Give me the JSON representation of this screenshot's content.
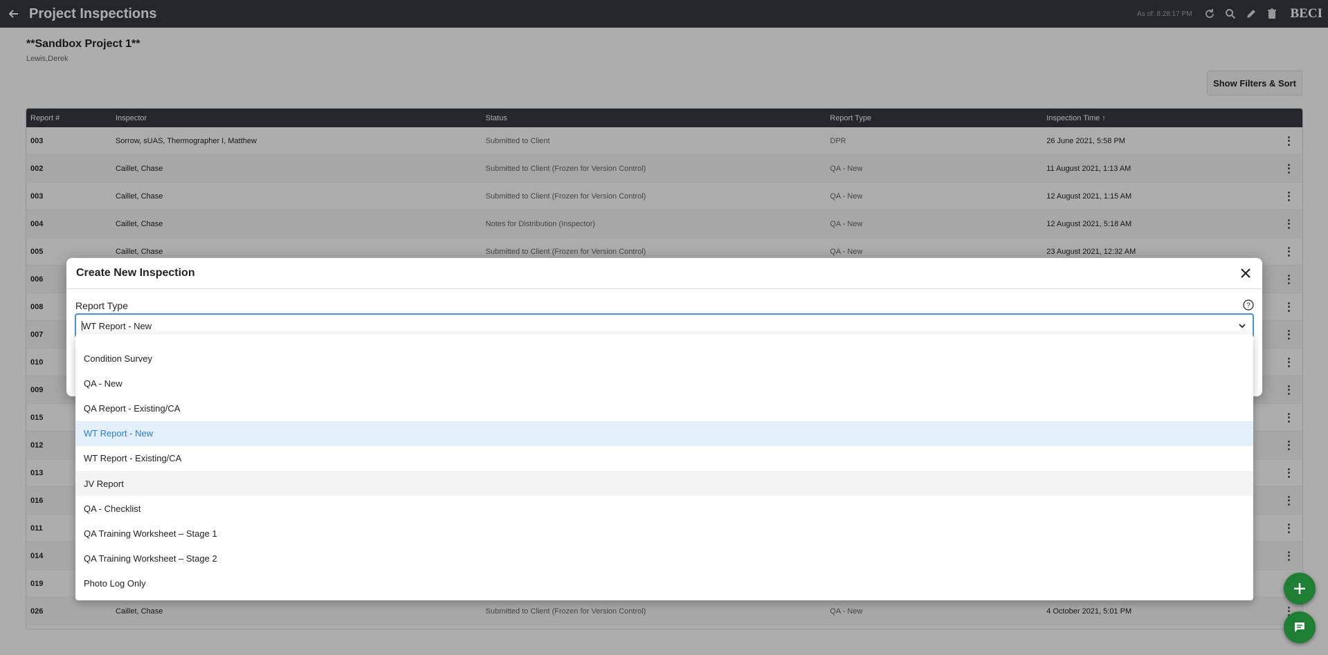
{
  "topbar": {
    "title": "Project Inspections",
    "as_of": "As of: 8:28:17 PM",
    "brand": "BECI"
  },
  "project": {
    "title": "**Sandbox Project 1**",
    "owner": "Lewis,Derek"
  },
  "filters_button": "Show Filters & Sort",
  "table": {
    "headers": [
      "Report #",
      "Inspector",
      "Status",
      "Report Type",
      "Inspection Time ↑"
    ],
    "rows": [
      [
        "003",
        "Sorrow, sUAS, Thermographer I, Matthew",
        "Submitted to Client",
        "DPR",
        "26 June 2021, 5:58 PM"
      ],
      [
        "002",
        "Caillet, Chase",
        "Submitted to Client (Frozen for Version Control)",
        "QA - New",
        "11 August 2021, 1:13 AM"
      ],
      [
        "003",
        "Caillet, Chase",
        "Submitted to Client (Frozen for Version Control)",
        "QA - New",
        "12 August 2021, 1:15 AM"
      ],
      [
        "004",
        "Caillet, Chase",
        "Notes for Distribution (Inspector)",
        "QA - New",
        "12 August 2021, 5:18 AM"
      ],
      [
        "005",
        "Caillet, Chase",
        "Submitted to Client (Frozen for Version Control)",
        "QA - New",
        "23 August 2021, 12:32 AM"
      ],
      [
        "006",
        "",
        "",
        "",
        ""
      ],
      [
        "008",
        "",
        "",
        "",
        ""
      ],
      [
        "007",
        "",
        "",
        "",
        ""
      ],
      [
        "010",
        "",
        "",
        "",
        ""
      ],
      [
        "009",
        "",
        "",
        "",
        ""
      ],
      [
        "015",
        "",
        "",
        "",
        ""
      ],
      [
        "012",
        "",
        "",
        "",
        ""
      ],
      [
        "013",
        "",
        "",
        "",
        ""
      ],
      [
        "016",
        "",
        "",
        "",
        ""
      ],
      [
        "011",
        "",
        "",
        "",
        ""
      ],
      [
        "014",
        "",
        "",
        "",
        ""
      ],
      [
        "019",
        "",
        "",
        "",
        ""
      ],
      [
        "026",
        "Caillet, Chase",
        "Submitted to Client (Frozen for Version Control)",
        "QA - New",
        "4 October 2021, 5:01 PM"
      ]
    ]
  },
  "modal": {
    "title": "Create New Inspection",
    "field_label": "Report Type",
    "selected_value": "WT Report - New",
    "options": [
      "Condition Survey",
      "QA - New",
      "QA Report - Existing/CA",
      "WT Report - New",
      "WT Report - Existing/CA",
      "JV Report",
      "QA - Checklist",
      "QA Training Worksheet – Stage 1",
      "QA Training Worksheet – Stage 2",
      "Photo Log Only"
    ],
    "selected_index": 3,
    "hover_index": 5
  },
  "colors": {
    "topbar": "#343a40",
    "accent_green": "#1e7e34",
    "select_border": "#4a90d9",
    "selected_text": "#2a7bd4"
  }
}
